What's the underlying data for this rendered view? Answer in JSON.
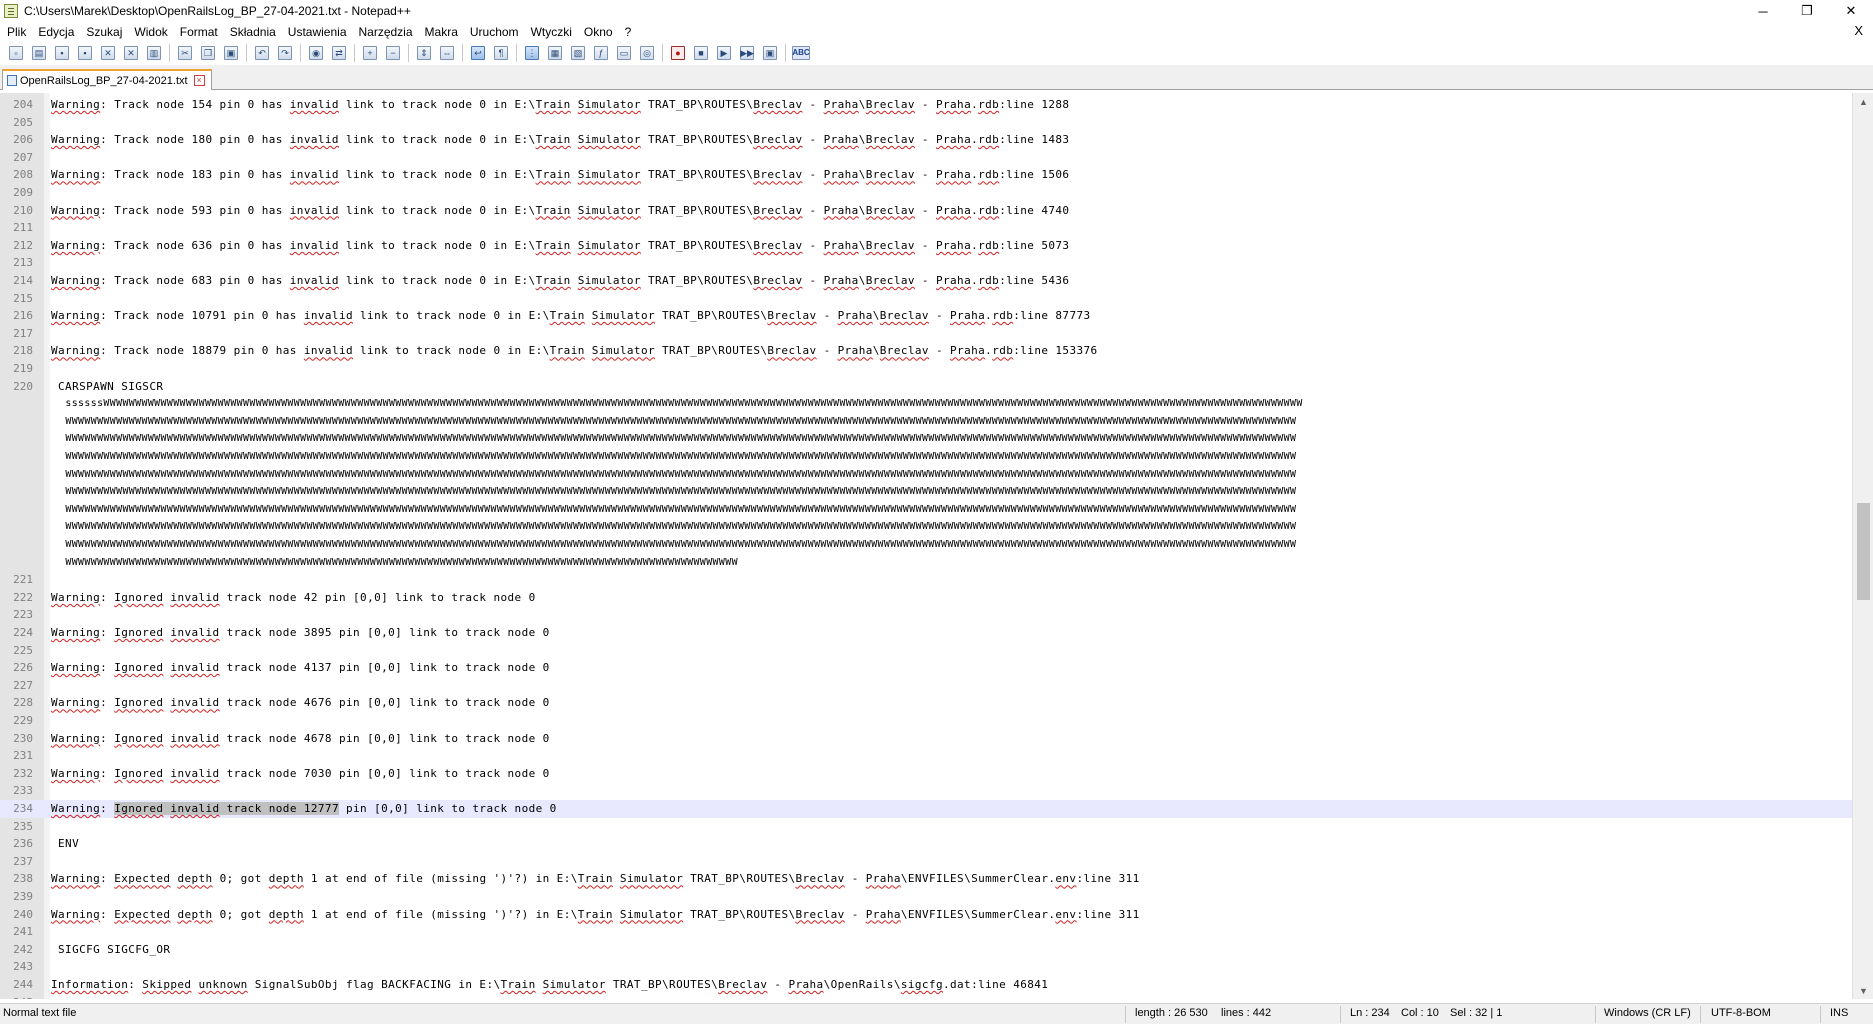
{
  "window": {
    "title": "C:\\Users\\Marek\\Desktop\\OpenRailsLog_BP_27-04-2021.txt - Notepad++",
    "minimize": "─",
    "restore": "❐",
    "close": "✕"
  },
  "menu": {
    "items": [
      "Plik",
      "Edycja",
      "Szukaj",
      "Widok",
      "Format",
      "Składnia",
      "Ustawienia",
      "Narzędzia",
      "Makra",
      "Uruchom",
      "Wtyczki",
      "Okno",
      "?"
    ],
    "doc_close": "X"
  },
  "toolbar": {
    "buttons": [
      {
        "name": "new-file-icon",
        "glyph": "▫"
      },
      {
        "name": "open-file-icon",
        "glyph": "▤"
      },
      {
        "name": "save-icon",
        "glyph": "▪"
      },
      {
        "name": "save-all-icon",
        "glyph": "▪"
      },
      {
        "name": "close-file-icon",
        "glyph": "✕"
      },
      {
        "name": "close-all-icon",
        "glyph": "✕"
      },
      {
        "name": "print-icon",
        "glyph": "▥"
      },
      {
        "name": "sep"
      },
      {
        "name": "cut-icon",
        "glyph": "✂"
      },
      {
        "name": "copy-icon",
        "glyph": "❐"
      },
      {
        "name": "paste-icon",
        "glyph": "▣"
      },
      {
        "name": "sep"
      },
      {
        "name": "undo-icon",
        "glyph": "↶"
      },
      {
        "name": "redo-icon",
        "glyph": "↷"
      },
      {
        "name": "sep"
      },
      {
        "name": "find-icon",
        "glyph": "◉"
      },
      {
        "name": "replace-icon",
        "glyph": "⇄"
      },
      {
        "name": "sep"
      },
      {
        "name": "zoom-in-icon",
        "glyph": "+"
      },
      {
        "name": "zoom-out-icon",
        "glyph": "−"
      },
      {
        "name": "sep"
      },
      {
        "name": "sync-vertical-icon",
        "glyph": "⇕"
      },
      {
        "name": "sync-horizontal-icon",
        "glyph": "⇔"
      },
      {
        "name": "sep"
      },
      {
        "name": "word-wrap-icon",
        "glyph": "↩",
        "active": true
      },
      {
        "name": "show-all-chars-icon",
        "glyph": "¶"
      },
      {
        "name": "sep"
      },
      {
        "name": "indent-guide-icon",
        "glyph": "⋮",
        "active": true
      },
      {
        "name": "user-lang-icon",
        "glyph": "▦"
      },
      {
        "name": "doc-map-icon",
        "glyph": "▧"
      },
      {
        "name": "function-list-icon",
        "glyph": "ƒ"
      },
      {
        "name": "folder-workspace-icon",
        "glyph": "▭"
      },
      {
        "name": "monitoring-icon",
        "glyph": "◎"
      },
      {
        "name": "sep"
      },
      {
        "name": "record-macro-icon",
        "glyph": "●",
        "red": true
      },
      {
        "name": "stop-macro-icon",
        "glyph": "■"
      },
      {
        "name": "play-macro-icon",
        "glyph": "▶"
      },
      {
        "name": "run-macro-multiple-icon",
        "glyph": "▶▶"
      },
      {
        "name": "save-macro-icon",
        "glyph": "▣"
      },
      {
        "name": "sep"
      },
      {
        "name": "spell-check-icon",
        "glyph": "ABC",
        "abc": true
      }
    ]
  },
  "tab": {
    "label": "OpenRailsLog_BP_27-04-2021.txt",
    "close_glyph": "×"
  },
  "editor": {
    "lines": [
      {
        "n": "204",
        "t": "Warning: Track node 154 pin 0 has invalid link to track node 0 in E:\\Train Simulator TRAT_BP\\ROUTES\\Breclav - Praha\\Breclav - Praha.rdb:line 1288"
      },
      {
        "n": "205",
        "t": ""
      },
      {
        "n": "206",
        "t": "Warning: Track node 180 pin 0 has invalid link to track node 0 in E:\\Train Simulator TRAT_BP\\ROUTES\\Breclav - Praha\\Breclav - Praha.rdb:line 1483"
      },
      {
        "n": "207",
        "t": ""
      },
      {
        "n": "208",
        "t": "Warning: Track node 183 pin 0 has invalid link to track node 0 in E:\\Train Simulator TRAT_BP\\ROUTES\\Breclav - Praha\\Breclav - Praha.rdb:line 1506"
      },
      {
        "n": "209",
        "t": ""
      },
      {
        "n": "210",
        "t": "Warning: Track node 593 pin 0 has invalid link to track node 0 in E:\\Train Simulator TRAT_BP\\ROUTES\\Breclav - Praha\\Breclav - Praha.rdb:line 4740"
      },
      {
        "n": "211",
        "t": ""
      },
      {
        "n": "212",
        "t": "Warning: Track node 636 pin 0 has invalid link to track node 0 in E:\\Train Simulator TRAT_BP\\ROUTES\\Breclav - Praha\\Breclav - Praha.rdb:line 5073"
      },
      {
        "n": "213",
        "t": ""
      },
      {
        "n": "214",
        "t": "Warning: Track node 683 pin 0 has invalid link to track node 0 in E:\\Train Simulator TRAT_BP\\ROUTES\\Breclav - Praha\\Breclav - Praha.rdb:line 5436"
      },
      {
        "n": "215",
        "t": ""
      },
      {
        "n": "216",
        "t": "Warning: Track node 10791 pin 0 has invalid link to track node 0 in E:\\Train Simulator TRAT_BP\\ROUTES\\Breclav - Praha\\Breclav - Praha.rdb:line 87773"
      },
      {
        "n": "217",
        "t": ""
      },
      {
        "n": "218",
        "t": "Warning: Track node 18879 pin 0 has invalid link to track node 0 in E:\\Train Simulator TRAT_BP\\ROUTES\\Breclav - Praha\\Breclav - Praha.rdb:line 153376"
      },
      {
        "n": "219",
        "t": ""
      },
      {
        "n": "220",
        "t": " CARSPAWN SIGSCR"
      },
      {
        "n": "",
        "t": " ssssssWWWWWWWWWWWWWWWWWWWWWWWWWWWWWWWWWWWWWWWWWWWWWWWWWWWWWWWWWWWWWWWWWWWWWWWWWWWWWWWWWWWWWWWWWWWWWWWWWWWWWWWWWWWWWWWWWWWWWWWWWWWWWWWWWWWWWWWWWWWWWWWWWWWWWWWWWWWWWWWWWWWWWWWWWWWWWWWWWWWWWWWWWWWWW",
        "wrap": true
      },
      {
        "n": "",
        "t": " WWWWWWWWWWWWWWWWWWWWWWWWWWWWWWWWWWWWWWWWWWWWWWWWWWWWWWWWWWWWWWWWWWWWWWWWWWWWWWWWWWWWWWWWWWWWWWWWWWWWWWWWWWWWWWWWWWWWWWWWWWWWWWWWWWWWWWWWWWWWWWWWWWWWWWWWWWWWWWWWWWWWWWWWWWWWWWWWWWWWWWWWWWWWWWWWWW",
        "wrap": true
      },
      {
        "n": "",
        "t": " WWWWWWWWWWWWWWWWWWWWWWWWWWWWWWWWWWWWWWWWWWWWWWWWWWWWWWWWWWWWWWWWWWWWWWWWWWWWWWWWWWWWWWWWWWWWWWWWWWWWWWWWWWWWWWWWWWWWWWWWWWWWWWWWWWWWWWWWWWWWWWWWWWWWWWWWWWWWWWWWWWWWWWWWWWWWWWWWWWWWWWWWWWWWWWWWWW",
        "wrap": true
      },
      {
        "n": "",
        "t": " WWWWWWWWWWWWWWWWWWWWWWWWWWWWWWWWWWWWWWWWWWWWWWWWWWWWWWWWWWWWWWWWWWWWWWWWWWWWWWWWWWWWWWWWWWWWWWWWWWWWWWWWWWWWWWWWWWWWWWWWWWWWWWWWWWWWWWWWWWWWWWWWWWWWWWWWWWWWWWWWWWWWWWWWWWWWWWWWWWWWWWWWWWWWWWWWWW",
        "wrap": true
      },
      {
        "n": "",
        "t": " WWWWWWWWWWWWWWWWWWWWWWWWWWWWWWWWWWWWWWWWWWWWWWWWWWWWWWWWWWWWWWWWWWWWWWWWWWWWWWWWWWWWWWWWWWWWWWWWWWWWWWWWWWWWWWWWWWWWWWWWWWWWWWWWWWWWWWWWWWWWWWWWWWWWWWWWWWWWWWWWWWWWWWWWWWWWWWWWWWWWWWWWWWWWWWWWWW",
        "wrap": true
      },
      {
        "n": "",
        "t": " WWWWWWWWWWWWWWWWWWWWWWWWWWWWWWWWWWWWWWWWWWWWWWWWWWWWWWWWWWWWWWWWWWWWWWWWWWWWWWWWWWWWWWWWWWWWWWWWWWWWWWWWWWWWWWWWWWWWWWWWWWWWWWWWWWWWWWWWWWWWWWWWWWWWWWWWWWWWWWWWWWWWWWWWWWWWWWWWWWWWWWWWWWWWWWWWWW",
        "wrap": true
      },
      {
        "n": "",
        "t": " WWWWWWWWWWWWWWWWWWWWWWWWWWWWWWWWWWWWWWWWWWWWWWWWWWWWWWWWWWWWWWWWWWWWWWWWWWWWWWWWWWWWWWWWWWWWWWWWWWWWWWWWWWWWWWWWWWWWWWWWWWWWWWWWWWWWWWWWWWWWWWWWWWWWWWWWWWWWWWWWWWWWWWWWWWWWWWWWWWWWWWWWWWWWWWWWWW",
        "wrap": true
      },
      {
        "n": "",
        "t": " WWWWWWWWWWWWWWWWWWWWWWWWWWWWWWWWWWWWWWWWWWWWWWWWWWWWWWWWWWWWWWWWWWWWWWWWWWWWWWWWWWWWWWWWWWWWWWWWWWWWWWWWWWWWWWWWWWWWWWWWWWWWWWWWWWWWWWWWWWWWWWWWWWWWWWWWWWWWWWWWWWWWWWWWWWWWWWWWWWWWWWWWWWWWWWWWWW",
        "wrap": true
      },
      {
        "n": "",
        "t": " WWWWWWWWWWWWWWWWWWWWWWWWWWWWWWWWWWWWWWWWWWWWWWWWWWWWWWWWWWWWWWWWWWWWWWWWWWWWWWWWWWWWWWWWWWWWWWWWWWWWWWWWWWWWWWWWWWWWWWWWWWWWWWWWWWWWWWWWWWWWWWWWWWWWWWWWWWWWWWWWWWWWWWWWWWWWWWWWWWWWWWWWWWWWWWWWWW",
        "wrap": true
      },
      {
        "n": "",
        "t": " WWWWWWWWWWWWWWWWWWWWWWWWWWWWWWWWWWWWWWWWWWWWWWWWWWWWWWWWWWWWWWWWWWWWWWWWWWWWWWWWWWWWWWWWWWWWWWWWWWWWWWWWWW",
        "wrap": true
      },
      {
        "n": "221",
        "t": ""
      },
      {
        "n": "222",
        "t": "Warning: Ignored invalid track node 42 pin [0,0] link to track node 0"
      },
      {
        "n": "223",
        "t": ""
      },
      {
        "n": "224",
        "t": "Warning: Ignored invalid track node 3895 pin [0,0] link to track node 0"
      },
      {
        "n": "225",
        "t": ""
      },
      {
        "n": "226",
        "t": "Warning: Ignored invalid track node 4137 pin [0,0] link to track node 0"
      },
      {
        "n": "227",
        "t": ""
      },
      {
        "n": "228",
        "t": "Warning: Ignored invalid track node 4676 pin [0,0] link to track node 0"
      },
      {
        "n": "229",
        "t": ""
      },
      {
        "n": "230",
        "t": "Warning: Ignored invalid track node 4678 pin [0,0] link to track node 0"
      },
      {
        "n": "231",
        "t": ""
      },
      {
        "n": "232",
        "t": "Warning: Ignored invalid track node 7030 pin [0,0] link to track node 0"
      },
      {
        "n": "233",
        "t": ""
      },
      {
        "n": "234",
        "t": "Warning: Ignored invalid track node 12777 pin [0,0] link to track node 0",
        "current": true,
        "sel_before": "Warning: ",
        "sel": "Ignored invalid track node 12777",
        "sel_after": " pin [0,0] link to track node 0"
      },
      {
        "n": "235",
        "t": ""
      },
      {
        "n": "236",
        "t": " ENV"
      },
      {
        "n": "237",
        "t": ""
      },
      {
        "n": "238",
        "t": "Warning: Expected depth 0; got depth 1 at end of file (missing ')'?) in E:\\Train Simulator TRAT_BP\\ROUTES\\Breclav - Praha\\ENVFILES\\SummerClear.env:line 311"
      },
      {
        "n": "239",
        "t": ""
      },
      {
        "n": "240",
        "t": "Warning: Expected depth 0; got depth 1 at end of file (missing ')'?) in E:\\Train Simulator TRAT_BP\\ROUTES\\Breclav - Praha\\ENVFILES\\SummerClear.env:line 311"
      },
      {
        "n": "241",
        "t": ""
      },
      {
        "n": "242",
        "t": " SIGCFG SIGCFG_OR"
      },
      {
        "n": "243",
        "t": ""
      },
      {
        "n": "244",
        "t": "Information: Skipped unknown SignalSubObj flag BACKFACING in E:\\Train Simulator TRAT_BP\\ROUTES\\Breclav - Praha\\OpenRails\\sigcfg.dat:line 46841"
      },
      {
        "n": "245",
        "t": ""
      }
    ],
    "spell_flagged": [
      "Warning",
      "invalid",
      "Train",
      "Simulator",
      "Breclav",
      "Praha",
      "rdb",
      "Ignored",
      "Expected",
      "depth",
      "env",
      "Information",
      "Skipped",
      "unknown",
      "sigcfg"
    ]
  },
  "scrollbar": {
    "up": "▲",
    "down": "▼"
  },
  "status": {
    "file_type": "Normal text file",
    "length": "length : 26 530",
    "lines": "lines : 442",
    "ln": "Ln : 234",
    "col": "Col : 10",
    "sel": "Sel : 32 | 1",
    "eol": "Windows (CR LF)",
    "encoding": "UTF-8-BOM",
    "mode": "INS"
  }
}
